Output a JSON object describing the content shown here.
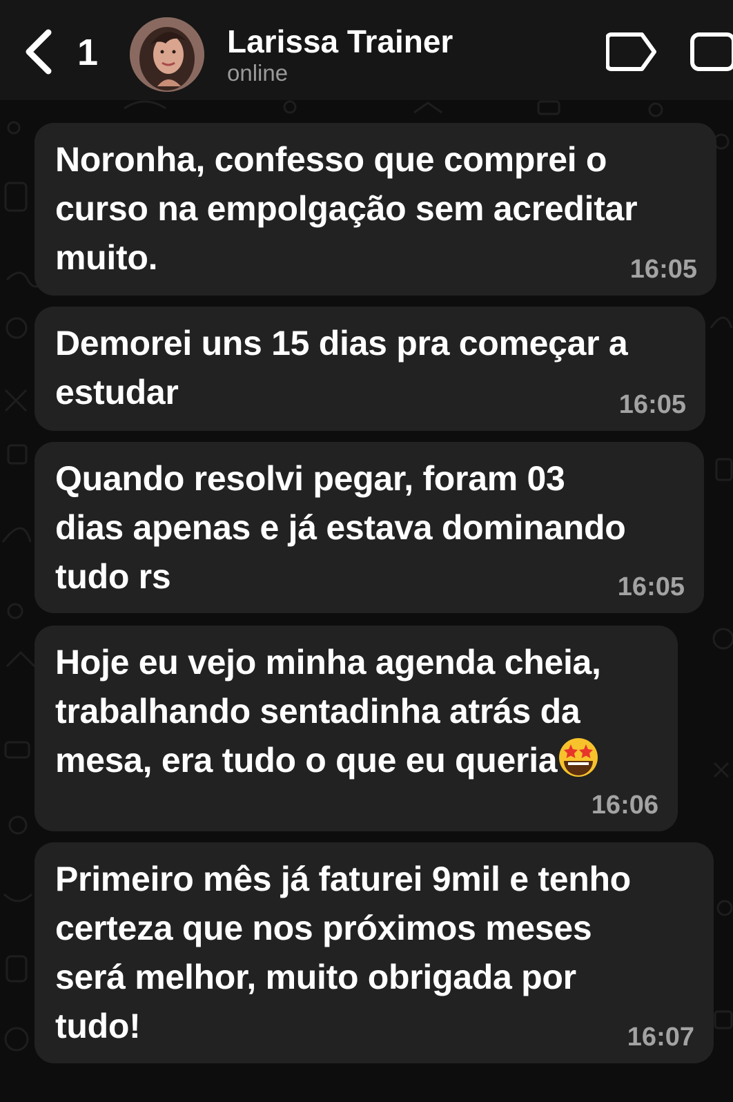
{
  "header": {
    "back_count": "1",
    "contact_name": "Larissa Trainer",
    "contact_status": "online",
    "back_icon": "chevron-left-icon",
    "label_icon": "label-tag-icon",
    "call_icon": "video-call-icon"
  },
  "colors": {
    "background": "#0d0d0d",
    "header": "#161616",
    "bubble": "#222222",
    "text": "#ffffff",
    "timestamp": "#a3a3a3",
    "status": "#9a9a9a"
  },
  "messages": [
    {
      "text": "Noronha, confesso que comprei o\ncurso na empolgação sem acreditar\nmuito.",
      "time": "16:05"
    },
    {
      "text": "Demorei uns 15 dias pra começar a\nestudar",
      "time": "16:05"
    },
    {
      "text": "Quando resolvi pegar, foram 03\ndias apenas e já estava dominando\ntudo rs",
      "time": "16:05"
    },
    {
      "text": "Hoje eu vejo minha agenda cheia,\ntrabalhando sentadinha atrás da\nmesa, era tudo o que eu queria",
      "emoji": "star-struck-emoji",
      "time": "16:06"
    },
    {
      "text": "Primeiro mês já faturei 9mil e tenho\ncerteza que nos próximos meses\nserá melhor, muito obrigada por\ntudo!",
      "time": "16:07"
    }
  ]
}
